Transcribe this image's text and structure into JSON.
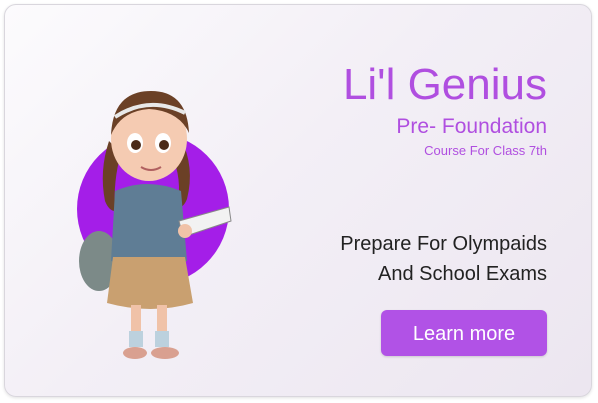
{
  "card": {
    "title": "Li'l Genius",
    "subtitle": "Pre- Foundation",
    "course": "Course For Class 7th",
    "tagline_line1": "Prepare For Olympaids",
    "tagline_line2": "And School Exams",
    "cta_label": "Learn more",
    "illustration": {
      "subject": "girl-student-holding-book-icon",
      "backdrop": "purple-circle"
    }
  },
  "colors": {
    "accent": "#b04fe0",
    "button": "#b152e6",
    "tagline_text": "#222222",
    "circle": "#a41ee8"
  }
}
